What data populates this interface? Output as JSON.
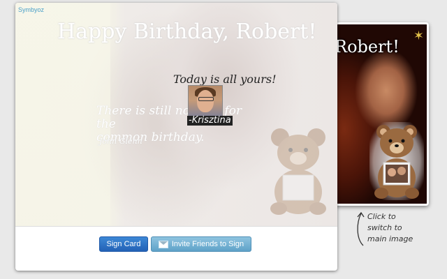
{
  "preview": {
    "title": "Robert!"
  },
  "card": {
    "brand": "Symbyoz",
    "headline": "Happy Birthday, Robert!",
    "quote_lines": [
      "There is still no cure for the",
      "common birthday."
    ],
    "quote_author": "John Glenn",
    "message": "Today is all yours!",
    "signer_name": "-Krisztina"
  },
  "actions": {
    "sign_label": "Sign Card",
    "invite_label": "Invite Friends to Sign"
  },
  "hint": {
    "lines": [
      "Click to",
      "switch to",
      "main image"
    ]
  },
  "colors": {
    "brand": "#4aa0c8",
    "primary_button": "#2f75c8",
    "secondary_button": "#74b3d6"
  }
}
